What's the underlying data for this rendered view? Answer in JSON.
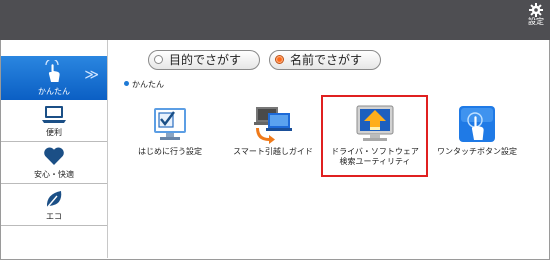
{
  "header": {
    "settings_label": "設定"
  },
  "sidebar": {
    "items": [
      {
        "label": "かんたん",
        "icon": "touch-hand-icon",
        "active": true
      },
      {
        "label": "便利",
        "icon": "laptop-icon"
      },
      {
        "label": "安心・快適",
        "icon": "heart-icon"
      },
      {
        "label": "エコ",
        "icon": "leaf-icon"
      }
    ],
    "active_chevron": "≫"
  },
  "search_modes": {
    "by_purpose": "目的でさがす",
    "by_name": "名前でさがす",
    "selected": "by_name"
  },
  "breadcrumb": {
    "label": "かんたん"
  },
  "apps": [
    {
      "name": "はじめに行う設定",
      "icon": "checklist-monitor-icon"
    },
    {
      "name": "スマート引越しガイド",
      "icon": "pc-transfer-icon"
    },
    {
      "name_line1": "ドライバ・ソフトウェア",
      "name_line2": "検索ユーティリティ",
      "icon": "driver-update-monitor-icon",
      "highlighted": true
    },
    {
      "name": "ワンタッチボタン設定",
      "icon": "one-touch-button-icon"
    }
  ],
  "colors": {
    "accent_blue": "#1e7ad6",
    "highlight_red": "#e02020",
    "topbar": "#4e4e52"
  }
}
